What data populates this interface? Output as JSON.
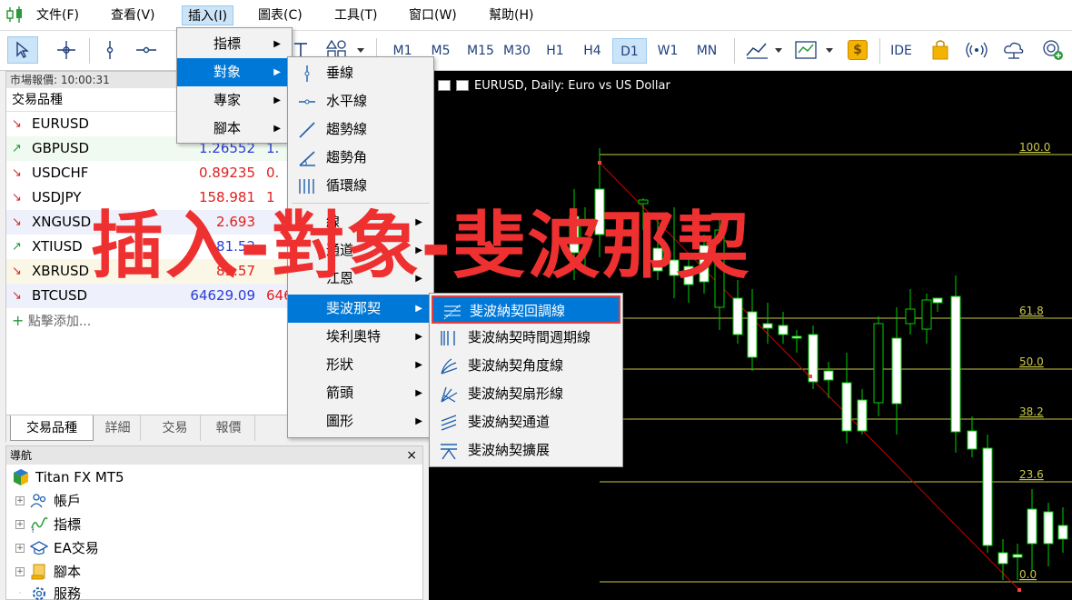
{
  "menubar": {
    "items": [
      "文件(F)",
      "查看(V)",
      "插入(I)",
      "圖表(C)",
      "工具(T)",
      "窗口(W)",
      "幫助(H)"
    ]
  },
  "toolbar": {
    "timeframes": [
      "M1",
      "M5",
      "M15",
      "M30",
      "H1",
      "H4",
      "D1",
      "W1",
      "MN"
    ],
    "active_timeframe": "D1",
    "ide_label": "IDE",
    "dollar_label": "$"
  },
  "market_watch": {
    "title": "市場報價: 10:00:31",
    "column_header": "交易品種",
    "rows": [
      {
        "symbol": "EURUSD",
        "bid": "",
        "ask": "",
        "dir": "down"
      },
      {
        "symbol": "GBPUSD",
        "bid": "1.26552",
        "ask": "1.",
        "dir": "up"
      },
      {
        "symbol": "USDCHF",
        "bid": "0.89235",
        "ask": "0.",
        "dir": "down"
      },
      {
        "symbol": "USDJPY",
        "bid": "158.981",
        "ask": "1",
        "dir": "down"
      },
      {
        "symbol": "XNGUSD",
        "bid": "2.693",
        "ask": "",
        "dir": "down"
      },
      {
        "symbol": "XTIUSD",
        "bid": "81.52",
        "ask": "",
        "dir": "up"
      },
      {
        "symbol": "XBRUSD",
        "bid": "85.57",
        "ask": "",
        "dir": "down"
      },
      {
        "symbol": "BTCUSD",
        "bid": "64629.09",
        "ask": "646",
        "dir": "down"
      }
    ],
    "add_label": "點擊添加...",
    "tabs": [
      "交易品種",
      "詳細",
      "交易",
      "報價"
    ]
  },
  "navigator": {
    "title": "導航",
    "close": "×",
    "root": "Titan FX MT5",
    "items": [
      "帳戶",
      "指標",
      "EA交易",
      "腳本",
      "服務"
    ]
  },
  "chart": {
    "title": "EURUSD, Daily:  Euro vs US Dollar",
    "fib_levels": [
      "100.0",
      "61.8",
      "50.0",
      "38.2",
      "23.6",
      "0.0"
    ]
  },
  "insert_menu": {
    "items": [
      "指標",
      "對象",
      "專家",
      "腳本"
    ]
  },
  "objects_menu": {
    "items": [
      "垂線",
      "水平線",
      "趨勢線",
      "趨勢角",
      "循環線",
      "線",
      "通道",
      "江恩",
      "斐波那契",
      "埃利奧特",
      "形狀",
      "箭頭",
      "圖形"
    ]
  },
  "fibo_menu": {
    "items": [
      "斐波納契回調線",
      "斐波納契時間週期線",
      "斐波納契角度線",
      "斐波納契扇形線",
      "斐波納契通道",
      "斐波納契擴展"
    ]
  },
  "caption": "插入-對象-斐波那契",
  "colors": {
    "accent": "#0078d7",
    "caption": "#ee3030",
    "fib_line": "#c8c84a",
    "candle_bull": "#00d000",
    "candle_body": "#ffffff",
    "trend_line": "#cc0000"
  }
}
